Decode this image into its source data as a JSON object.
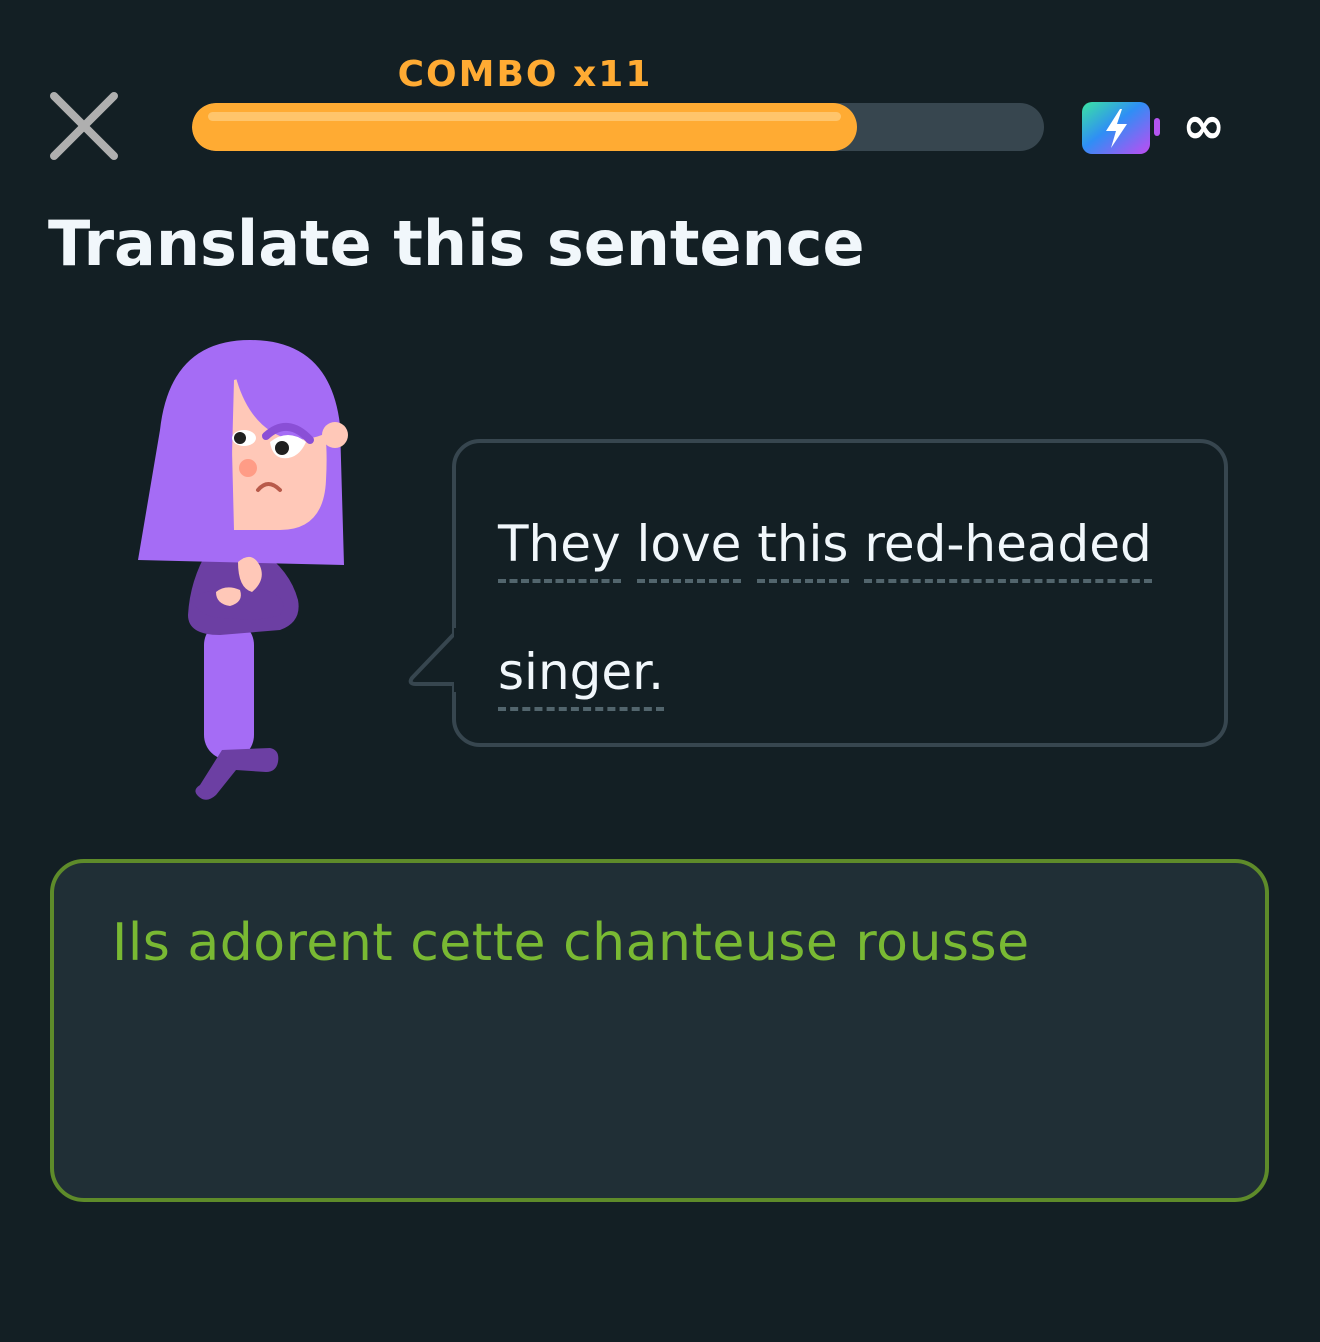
{
  "header": {
    "close_icon": "close-icon",
    "combo_label": "COMBO x11",
    "progress": 0.78,
    "energy_icon": "energy-battery-icon",
    "energy_count": "∞"
  },
  "exercise": {
    "title": "Translate this sentence",
    "character_icon": "purple-haired-character",
    "prompt_words": [
      "They",
      "love",
      "this",
      "red-headed",
      "singer."
    ]
  },
  "answer": {
    "value": "Ils adorent cette chanteuse rousse"
  },
  "colors": {
    "background": "#131f24",
    "accent_orange": "#ffab33",
    "answer_green": "#79b933",
    "answer_border": "#5e8b2a",
    "character_purple": "#a56cf5"
  }
}
